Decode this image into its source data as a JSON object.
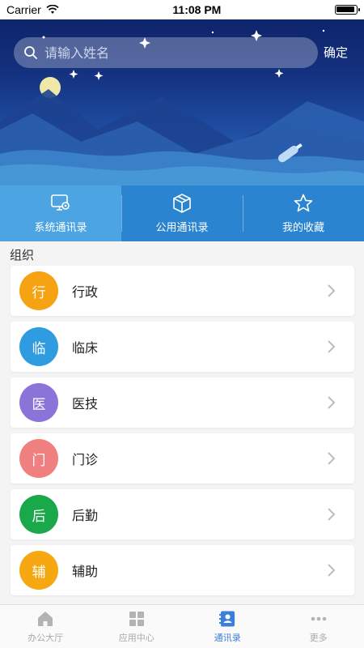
{
  "status": {
    "carrier": "Carrier",
    "time": "11:08 PM",
    "battery_level": 0.95
  },
  "search": {
    "placeholder": "请输入姓名",
    "confirm_label": "确定"
  },
  "tabs": [
    {
      "label": "系统通讯录",
      "icon": "monitor-gear-icon",
      "active": true
    },
    {
      "label": "公用通讯录",
      "icon": "box-icon",
      "active": false
    },
    {
      "label": "我的收藏",
      "icon": "star-icon",
      "active": false
    }
  ],
  "section": {
    "title": "组织"
  },
  "orgs": [
    {
      "avatar": "行",
      "label": "行政",
      "color": "#f5a312"
    },
    {
      "avatar": "临",
      "label": "临床",
      "color": "#2f9be0"
    },
    {
      "avatar": "医",
      "label": "医技",
      "color": "#8a74d8"
    },
    {
      "avatar": "门",
      "label": "门诊",
      "color": "#f08080"
    },
    {
      "avatar": "后",
      "label": "后勤",
      "color": "#19a84a"
    },
    {
      "avatar": "辅",
      "label": "辅助",
      "color": "#f5a812"
    }
  ],
  "nav": [
    {
      "label": "办公大厅",
      "icon": "home-icon",
      "active": false
    },
    {
      "label": "应用中心",
      "icon": "grid-icon",
      "active": false
    },
    {
      "label": "通讯录",
      "icon": "contacts-icon",
      "active": true
    },
    {
      "label": "更多",
      "icon": "more-icon",
      "active": false
    }
  ]
}
